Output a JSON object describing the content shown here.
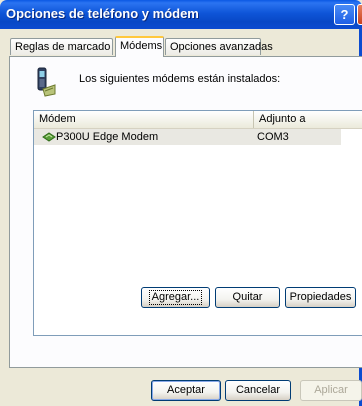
{
  "window": {
    "title": "Opciones de teléfono y módem",
    "help_button": "?",
    "close_button": "X"
  },
  "tabs": [
    {
      "label": "Reglas de marcado",
      "active": false
    },
    {
      "label": "Módems",
      "active": true
    },
    {
      "label": "Opciones avanzadas",
      "active": false
    }
  ],
  "panel": {
    "icon": "phone-modem-icon",
    "intro_text": "Los siguientes módems están instalados:",
    "list": {
      "columns": [
        "Módem",
        "Adjunto a"
      ],
      "rows": [
        {
          "icon": "modem-icon",
          "name": "P300U Edge Modem",
          "attached_to": "COM3",
          "selected": true
        }
      ]
    },
    "buttons": {
      "add": "Agregar...",
      "remove": "Quitar",
      "properties": "Propiedades"
    }
  },
  "footer_buttons": {
    "ok": "Aceptar",
    "cancel": "Cancelar",
    "apply": "Aplicar"
  },
  "colors": {
    "titlebar": "#0c4bd0",
    "tab_highlight": "#ffc83c",
    "dialog_bg": "#ece9d8"
  }
}
